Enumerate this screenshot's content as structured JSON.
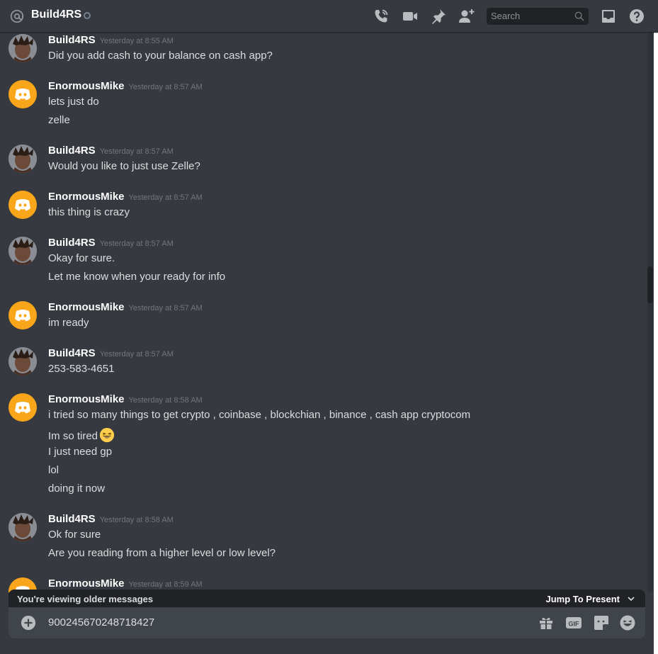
{
  "header": {
    "title": "Build4RS",
    "search_placeholder": "Search"
  },
  "messages": [
    {
      "author": "Build4RS",
      "timestamp": "Yesterday at 8:55 AM",
      "lines": [
        "Did you add cash to your balance on cash app?"
      ]
    },
    {
      "author": "EnormousMike",
      "timestamp": "Yesterday at 8:57 AM",
      "lines": [
        "lets just do",
        "zelle"
      ]
    },
    {
      "author": "Build4RS",
      "timestamp": "Yesterday at 8:57 AM",
      "lines": [
        "Would you like to just use Zelle?"
      ]
    },
    {
      "author": "EnormousMike",
      "timestamp": "Yesterday at 8:57 AM",
      "lines": [
        "this thing is crazy"
      ]
    },
    {
      "author": "Build4RS",
      "timestamp": "Yesterday at 8:57 AM",
      "lines": [
        "Okay for sure.",
        "Let me know when your ready for info"
      ]
    },
    {
      "author": "EnormousMike",
      "timestamp": "Yesterday at 8:57 AM",
      "lines": [
        "im ready"
      ]
    },
    {
      "author": "Build4RS",
      "timestamp": "Yesterday at 8:57 AM",
      "lines": [
        "253-583-4651"
      ]
    },
    {
      "author": "EnormousMike",
      "timestamp": "Yesterday at 8:58 AM",
      "lines": [
        "i tried so many things to get crypto , coinbase , blockchian , binance , cash app cryptocom",
        "Im so tired",
        "I just need gp",
        "lol",
        "doing it now"
      ]
    },
    {
      "author": "Build4RS",
      "timestamp": "Yesterday at 8:58 AM",
      "lines": [
        "Ok for sure",
        "Are you reading from a higher level or low level?"
      ]
    },
    {
      "author": "EnormousMike",
      "timestamp": "Yesterday at 8:59 AM",
      "lines": []
    }
  ],
  "older_bar": {
    "text": "You're viewing older messages",
    "jump": "Jump To Present"
  },
  "composer": {
    "value": "900245670248718427"
  },
  "colors": {
    "background": "#36393f",
    "composer": "#40444b",
    "discord_avatar": "#faa61a"
  }
}
